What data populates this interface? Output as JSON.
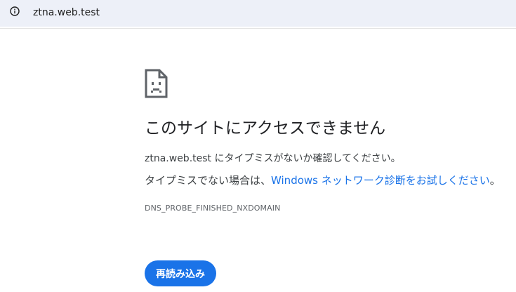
{
  "address_bar": {
    "url": "ztna.web.test",
    "icon": "info-icon"
  },
  "error_page": {
    "icon": "sad-page-icon",
    "heading": "このサイトにアクセスできません",
    "line1": "ztna.web.test にタイプミスがないか確認してください。",
    "line2_prefix": "タイプミスでない場合は、",
    "line2_link": "Windows ネットワーク診断をお試しください",
    "line2_suffix": "。",
    "error_code": "DNS_PROBE_FINISHED_NXDOMAIN",
    "reload_label": "再読み込み"
  },
  "colors": {
    "link": "#1a73e8",
    "button": "#1a73e8",
    "address_bar_bg": "#edf0f8"
  }
}
